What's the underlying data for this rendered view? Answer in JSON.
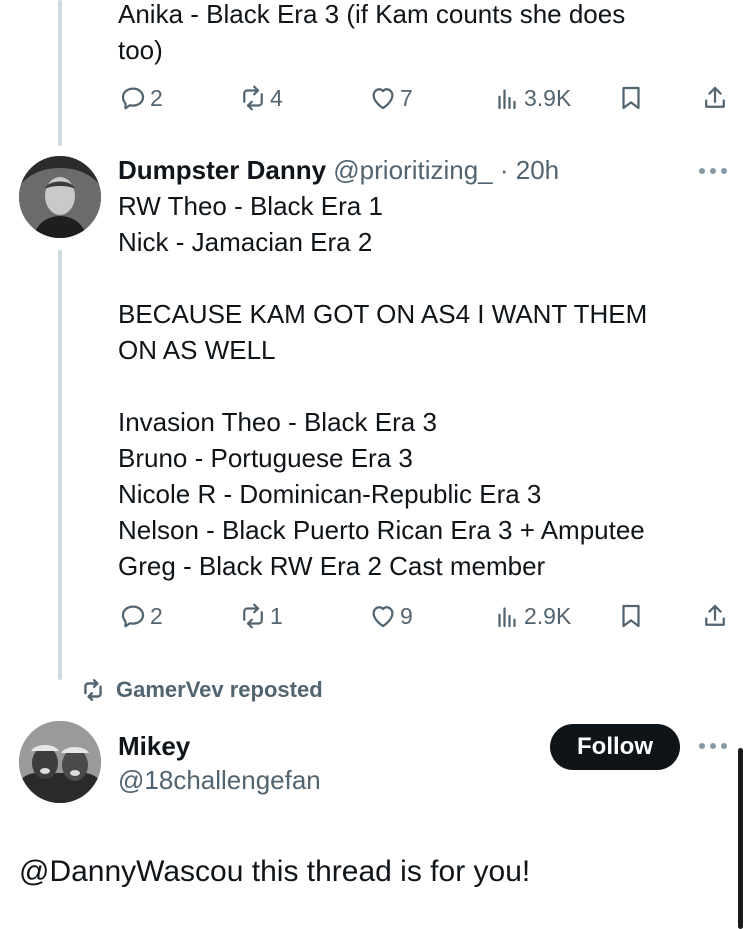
{
  "post1": {
    "lines": [
      "Anika - Black Era 3 (if Kam counts she does",
      "too)"
    ],
    "replies": "2",
    "reposts": "4",
    "likes": "7",
    "views": "3.9K"
  },
  "post2": {
    "name": "Dumpster Danny",
    "handle": "@prioritizing_",
    "time": "· 20h",
    "lines": [
      "RW Theo - Black Era 1",
      "Nick - Jamacian Era 2",
      "",
      "BECAUSE KAM GOT ON AS4 I WANT THEM",
      "ON AS WELL",
      "",
      "Invasion Theo - Black Era 3",
      "Bruno - Portuguese Era 3",
      "Nicole R - Dominican-Republic Era 3",
      "Nelson - Black Puerto Rican Era 3 + Amputee",
      "Greg - Black RW Era 2 Cast member"
    ],
    "replies": "2",
    "reposts": "1",
    "likes": "9",
    "views": "2.9K"
  },
  "repost_banner": "GamerVev reposted",
  "post3": {
    "name": "Mikey",
    "handle": "@18challengefan",
    "follow_label": "Follow",
    "text": "@DannyWascou this thread is for you!"
  },
  "icons": {
    "reply": "reply-icon",
    "repost": "repost-icon",
    "like": "heart-icon",
    "views": "views-icon",
    "bookmark": "bookmark-icon",
    "share": "share-icon",
    "more": "more-icon"
  }
}
